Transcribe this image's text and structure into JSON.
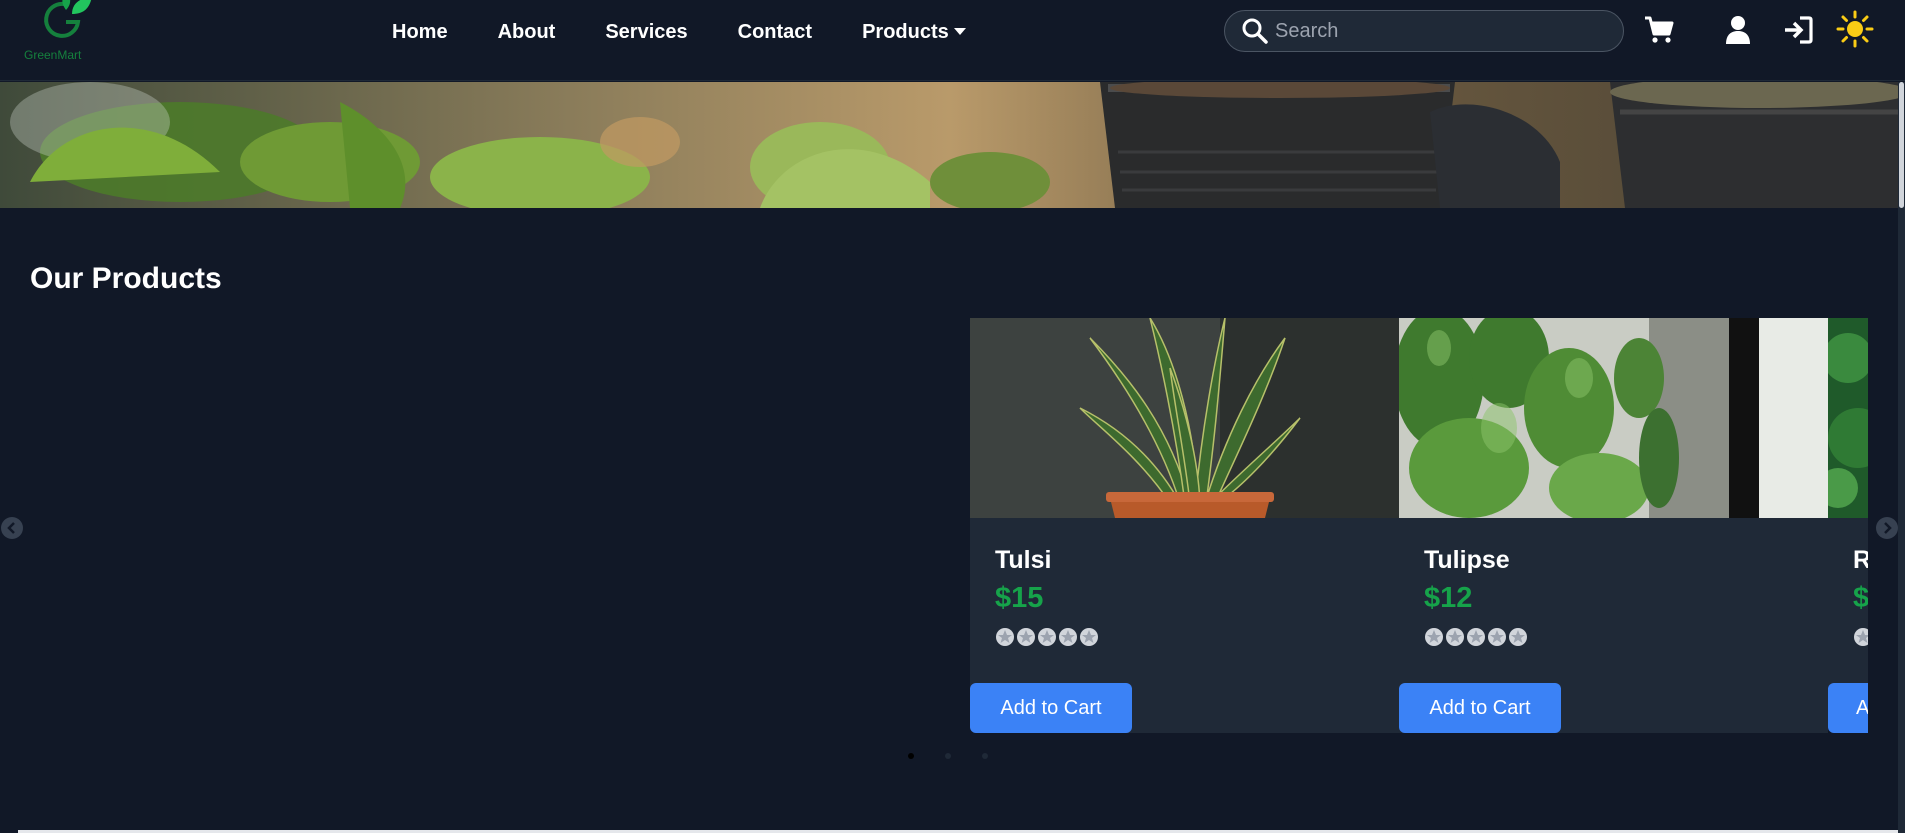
{
  "header": {
    "logo_text": "GreenMart",
    "nav": [
      {
        "label": "Home"
      },
      {
        "label": "About"
      },
      {
        "label": "Services"
      },
      {
        "label": "Contact"
      },
      {
        "label": "Products",
        "has_dropdown": true
      }
    ],
    "search": {
      "placeholder": "Search",
      "value": ""
    },
    "icons": [
      "cart-icon",
      "user-icon",
      "login-icon",
      "sun-icon"
    ]
  },
  "hero": {
    "image": "potted-plants-banner"
  },
  "products": {
    "title": "Our Products",
    "cards": [
      {
        "name": "Tulsi",
        "price": "$15",
        "rating": 5,
        "button": "Add to Cart",
        "image": "snake-plant"
      },
      {
        "name": "Tulipse",
        "price": "$12",
        "rating": 5,
        "button": "Add to Cart",
        "image": "pothos-plant"
      },
      {
        "name": "R",
        "price": "$",
        "rating": 5,
        "button": "A",
        "image": "green-foliage"
      }
    ],
    "carousel": {
      "dots": 3,
      "active_dot": 0
    }
  },
  "colors": {
    "background": "#111827",
    "card": "#1f2937",
    "accent_green": "#16a34a",
    "button_blue": "#3b82f6",
    "sun": "#facc15"
  }
}
